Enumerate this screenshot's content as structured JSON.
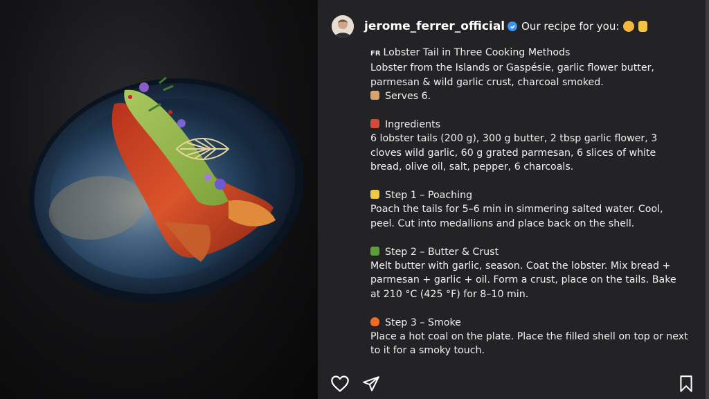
{
  "post": {
    "username": "jerome_ferrer_official",
    "header_text": "Our recipe for you:",
    "title_flag": "FR",
    "title": "Lobster Tail in Three Cooking Methods",
    "subtitle": "Lobster from the Islands or Gaspésie, garlic flower butter, parmesan & wild garlic crust, charcoal smoked.",
    "serves": "Serves 6.",
    "ingredients_heading": "Ingredients",
    "ingredients_text": "6 lobster tails (200 g), 300 g butter, 2 tbsp garlic flower, 3 cloves wild garlic, 60 g grated parmesan, 6 slices of white bread, olive oil, salt, pepper, 6 charcoals.",
    "step1_heading": "Step 1 – Poaching",
    "step1_text": "Poach the tails for 5–6 min in simmering salted water. Cool, peel. Cut into medallions and place back on the shell.",
    "step2_heading": "Step 2 – Butter & Crust",
    "step2_text": "Melt butter with garlic, season. Coat the lobster. Mix bread + parmesan + garlic + oil. Form a crust, place on the tails. Bake at 210 °C (425 °F) for 8–10 min.",
    "step3_heading": "Step 3 – Smoke",
    "step3_text": "Place a hot coal on the plate. Place the filled shell on top or next to it for a smoky touch."
  },
  "icons": {
    "verified": "verified-badge-icon",
    "like": "heart-icon",
    "share": "paper-plane-icon",
    "save": "bookmark-icon"
  },
  "colors": {
    "panel_bg": "#232325",
    "verified": "#3897f0",
    "text": "#f0f0f0"
  }
}
